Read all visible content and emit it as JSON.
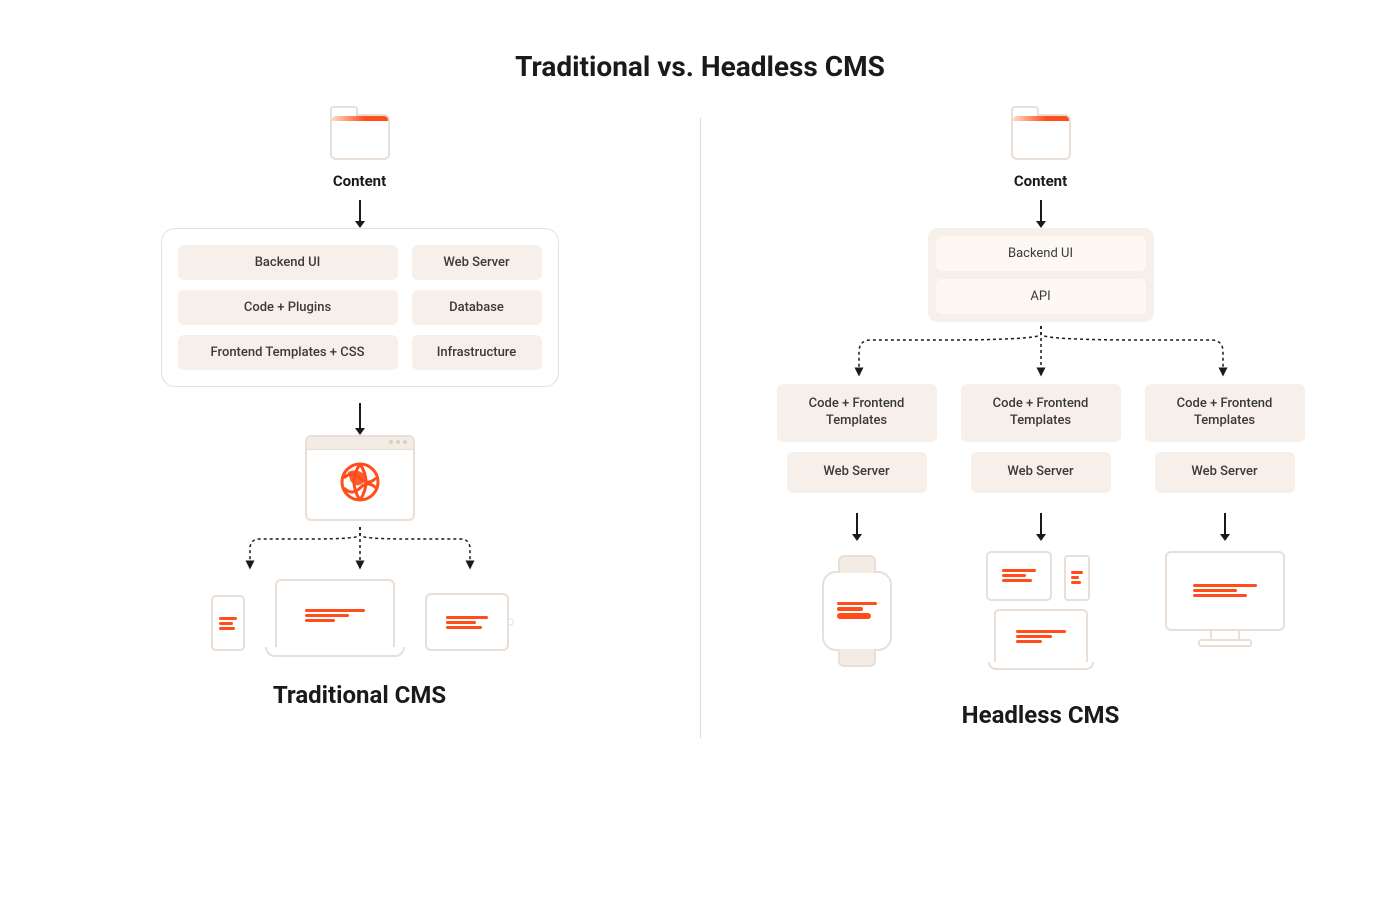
{
  "title": "Traditional vs. Headless CMS",
  "left": {
    "content_label": "Content",
    "stack": {
      "col1": [
        "Backend UI",
        "Code + Plugins",
        "Frontend Templates + CSS"
      ],
      "col2": [
        "Web Server",
        "Database",
        "Infrastructure"
      ]
    },
    "subtitle": "Traditional CMS"
  },
  "right": {
    "content_label": "Content",
    "core": [
      "Backend UI",
      "API"
    ],
    "branches": [
      {
        "line1": "Code + Frontend Templates",
        "line2": "Web Server"
      },
      {
        "line1": "Code + Frontend Templates",
        "line2": "Web Server"
      },
      {
        "line1": "Code + Frontend Templates",
        "line2": "Web Server"
      }
    ],
    "subtitle": "Headless CMS"
  },
  "colors": {
    "accent": "#ff4d1c",
    "line": "#e9dfd6",
    "pill_bg": "#f7f0ea"
  }
}
